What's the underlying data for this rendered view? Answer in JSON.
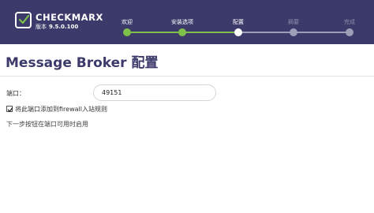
{
  "brand": {
    "name": "CHECKMARX",
    "version_label": "版本",
    "version_number": "9.5.0.100"
  },
  "steps": [
    {
      "label": "欢迎",
      "status": "done"
    },
    {
      "label": "安装选项",
      "status": "done"
    },
    {
      "label": "配置",
      "status": "current"
    },
    {
      "label": "摘要",
      "status": "todo"
    },
    {
      "label": "完成",
      "status": "todo"
    }
  ],
  "page": {
    "title": "Message Broker 配置"
  },
  "form": {
    "port_label": "端口：",
    "port_value": "49151",
    "firewall_checkbox_label": "将此端口添加到firewall入站规则",
    "firewall_checked": true,
    "hint": "下一步按钮在端口可用时启用"
  },
  "colors": {
    "header_bg": "#3b3a6b",
    "step_done": "#7ec04a",
    "step_todo": "#9f9eb8",
    "title": "#3b3a6b"
  }
}
